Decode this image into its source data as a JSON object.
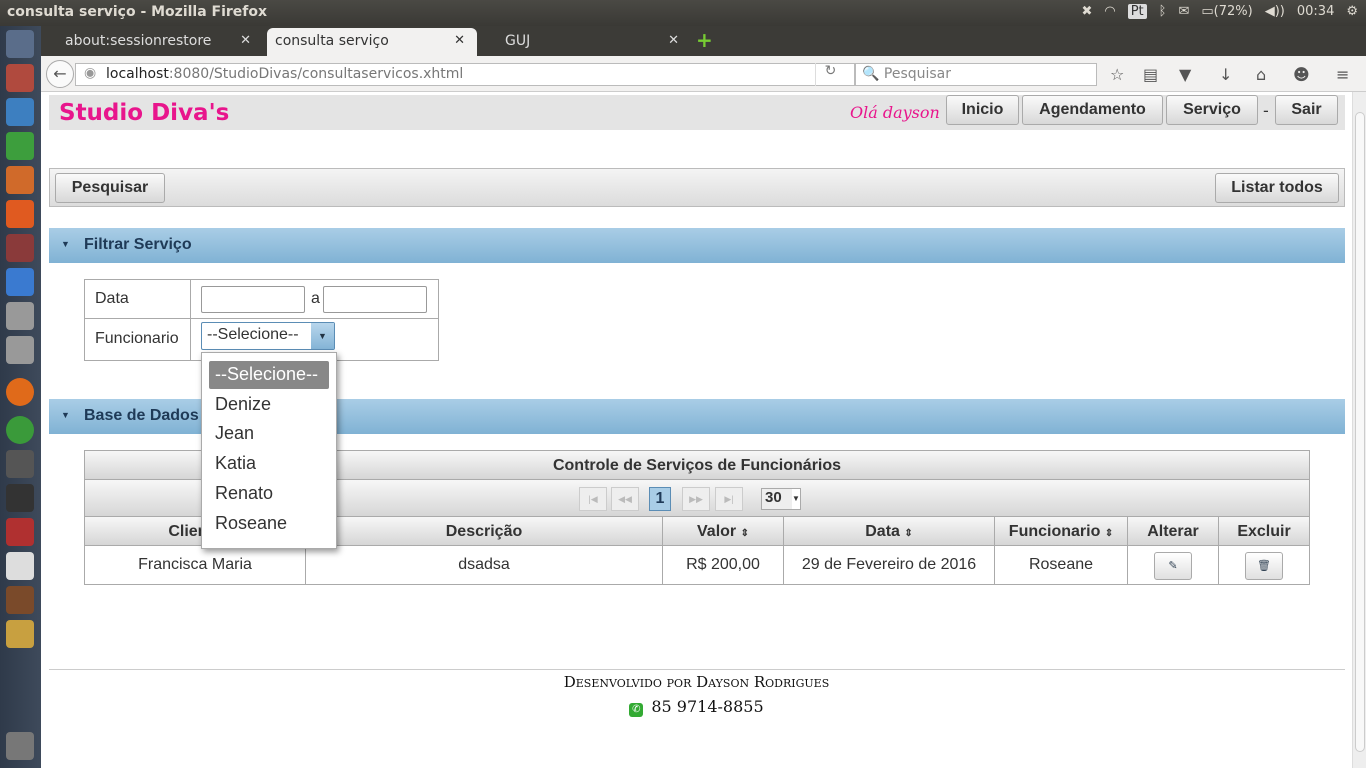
{
  "os": {
    "window_title": "consulta serviço - Mozilla Firefox",
    "keyboard": "Pt",
    "battery": "(72%)",
    "time": "00:34"
  },
  "browser": {
    "tabs": [
      {
        "label": "about:sessionrestore"
      },
      {
        "label": "consulta serviço"
      },
      {
        "label": "GUJ"
      }
    ],
    "url_host": "localhost",
    "url_rest": ":8080/StudioDivas/consultaservicos.xhtml",
    "search_placeholder": "Pesquisar"
  },
  "header": {
    "brand": "Studio Diva's",
    "greeting": "Olá dayson",
    "nav": [
      "Inicio",
      "Agendamento",
      "Serviço",
      "Sair"
    ],
    "separator": "-"
  },
  "toolbar": {
    "search": "Pesquisar",
    "list_all": "Listar todos"
  },
  "filter": {
    "title": "Filtrar Serviço",
    "date_label": "Data",
    "date_sep": "a",
    "date_from": "",
    "date_to": "",
    "employee_label": "Funcionario",
    "employee_selected": "--Selecione--",
    "options": [
      "--Selecione--",
      "Denize",
      "Jean",
      "Katia",
      "Renato",
      "Roseane"
    ]
  },
  "database": {
    "title": "Base de Dados",
    "table_title": "Controle de Serviços de Funcionários",
    "current_page": "1",
    "rows_per_page": "30",
    "columns": [
      "Cliente",
      "Descrição",
      "Valor",
      "Data",
      "Funcionario",
      "Alterar",
      "Excluir"
    ],
    "rows": [
      {
        "cliente": "Francisca Maria",
        "descricao": "dsadsa",
        "valor": "R$ 200,00",
        "data": "29 de Fevereiro de 2016",
        "funcionario": "Roseane"
      }
    ]
  },
  "footer": {
    "developer": "Desenvolvido por Dayson Rodrigues",
    "phone": "85 9714-8855"
  },
  "colors": {
    "brand": "#e8158c",
    "panel": "#80b2d4"
  }
}
